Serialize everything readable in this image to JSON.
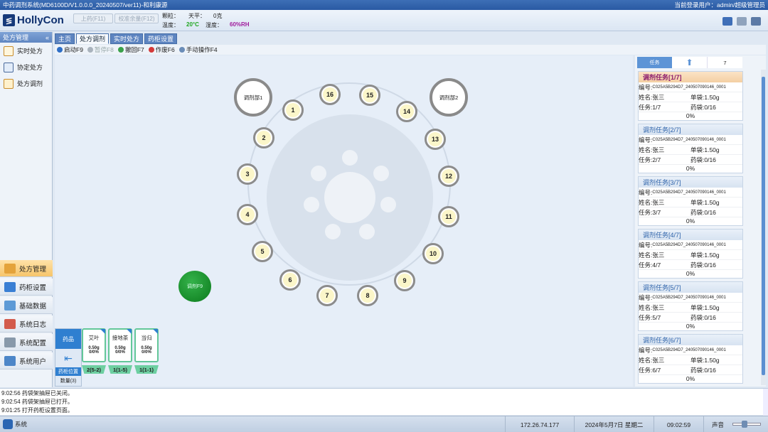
{
  "window": {
    "title": "中药调剂系统(MD6100D/V1.0.0.0_20240507/ver11)-和利康源",
    "current_user": "当前登录用户：admin/超级管理员"
  },
  "header": {
    "logo": "HollyCon",
    "btn_prev": "上药(F11)",
    "btn_calib": "校准余量(F12)",
    "granules_label": "颗粒：",
    "balance_label": "天平：",
    "balance_value": "0克",
    "temp_label": "温度：",
    "temp_value": "20°C",
    "humidity_label": "湿度：",
    "humidity_value": "60%RH"
  },
  "left": {
    "title": "处方管理",
    "collapse": "«",
    "items": [
      {
        "label": "实时处方",
        "icon": "pen-note-icon"
      },
      {
        "label": "协定处方",
        "icon": "book-icon"
      },
      {
        "label": "处方调剂",
        "icon": "document-icon"
      }
    ],
    "nav": [
      {
        "label": "处方管理",
        "icon": "prescription-icon",
        "color": "#e4a33b"
      },
      {
        "label": "药柜设置",
        "icon": "cabinet-icon",
        "color": "#3a7fd4"
      },
      {
        "label": "基础数据",
        "icon": "table-icon",
        "color": "#5d9ad6"
      },
      {
        "label": "系统日志",
        "icon": "calendar-icon",
        "color": "#d35b4c"
      },
      {
        "label": "系统配置",
        "icon": "settings-icon",
        "color": "#8899aa"
      },
      {
        "label": "系统用户",
        "icon": "users-icon",
        "color": "#4d86c8"
      }
    ]
  },
  "tabs": [
    "主页",
    "处方调剂",
    "实时处方",
    "药柜设置"
  ],
  "toolbar": {
    "start": "启动F9",
    "pause": "暂停F8",
    "undo": "撤回F7",
    "void": "作废F6",
    "manual": "手动操作F4"
  },
  "wheel": {
    "slots": [
      "1",
      "2",
      "3",
      "4",
      "5",
      "6",
      "7",
      "8",
      "9",
      "10",
      "11",
      "12",
      "13",
      "14",
      "15",
      "16"
    ],
    "dispenser1": "调剂部1",
    "dispenser2": "调剂部2",
    "dispense_button": "调剂F9"
  },
  "drawer": {
    "header": "药品",
    "location": "药柜位置",
    "count": "数量(3)"
  },
  "herbs": [
    {
      "name": "艾叶",
      "weight": "0.50g",
      "progress": "0/0%",
      "pos": "2(5-2)"
    },
    {
      "name": "接地茶",
      "weight": "0.50g",
      "progress": "0/0%",
      "pos": "1(1-5)"
    },
    {
      "name": "当归",
      "weight": "0.50g",
      "progress": "0/0%",
      "pos": "1(1-1)"
    }
  ],
  "right": {
    "tab_task": "任务",
    "count": "7",
    "tasks": [
      {
        "title": "调剂任务[1/7]",
        "code_label": "编号:",
        "code": "C025A5B294D7_240507090146_0001",
        "name": "姓名:张三",
        "dose": "单袋:1.50g",
        "task": "任务:1/7",
        "bag": "药袋:0/16",
        "pct": "0%"
      },
      {
        "title": "调剂任务[2/7]",
        "code_label": "编号:",
        "code": "C025A5B294D7_240507090146_0001",
        "name": "姓名:张三",
        "dose": "单袋:1.50g",
        "task": "任务:2/7",
        "bag": "药袋:0/16",
        "pct": "0%"
      },
      {
        "title": "调剂任务[3/7]",
        "code_label": "编号:",
        "code": "C025A5B294D7_240507090146_0001",
        "name": "姓名:张三",
        "dose": "单袋:1.50g",
        "task": "任务:3/7",
        "bag": "药袋:0/16",
        "pct": "0%"
      },
      {
        "title": "调剂任务[4/7]",
        "code_label": "编号:",
        "code": "C025A5B294D7_240507090146_0001",
        "name": "姓名:张三",
        "dose": "单袋:1.50g",
        "task": "任务:4/7",
        "bag": "药袋:0/16",
        "pct": "0%"
      },
      {
        "title": "调剂任务[5/7]",
        "code_label": "编号:",
        "code": "C025A5B294D7_240507090146_0001",
        "name": "姓名:张三",
        "dose": "单袋:1.50g",
        "task": "任务:5/7",
        "bag": "药袋:0/16",
        "pct": "0%"
      },
      {
        "title": "调剂任务[6/7]",
        "code_label": "编号:",
        "code": "C025A5B294D7_240507090146_0001",
        "name": "姓名:张三",
        "dose": "单袋:1.50g",
        "task": "任务:6/7",
        "bag": "药袋:0/16",
        "pct": "0%"
      }
    ]
  },
  "log": [
    "9:02:56 药袋架抽屉已关闭。",
    "9:02:54 药袋架抽屉已打开。",
    "9:01:25 打开药柜设置页面。"
  ],
  "status": {
    "system": "系统",
    "ip": "172.26.74.177",
    "date": "2024年5月7日 星期二",
    "time": "09:02:59",
    "sound": "声音"
  }
}
